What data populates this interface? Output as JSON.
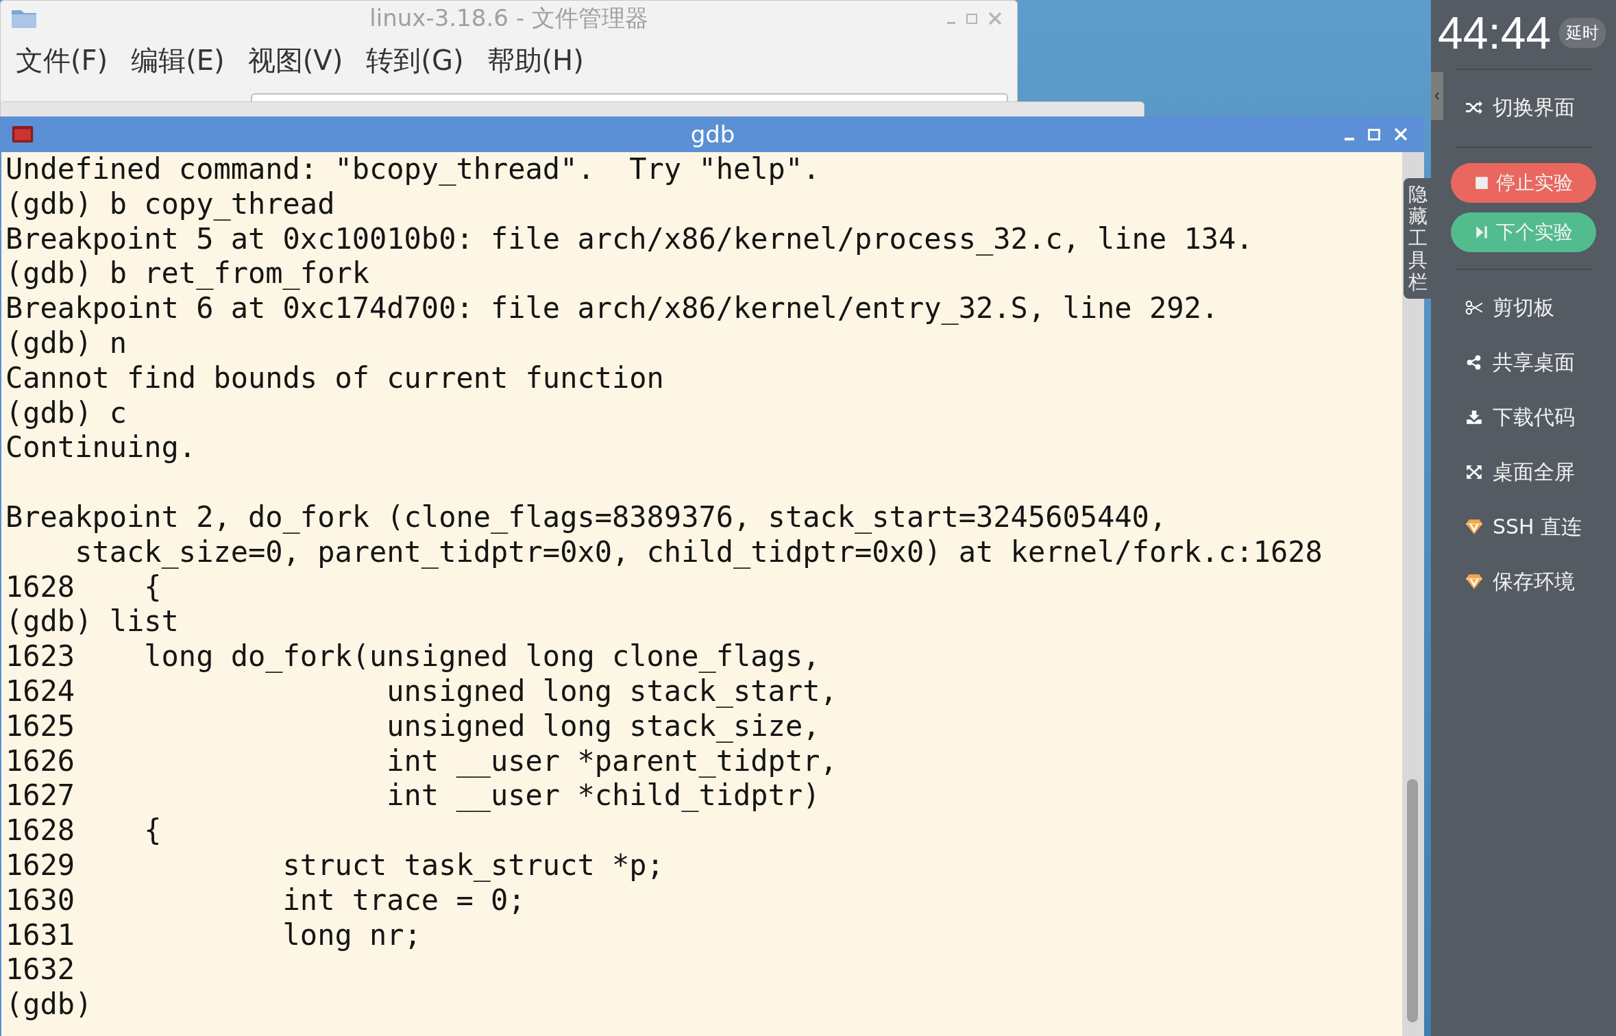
{
  "file_manager": {
    "title": "linux-3.18.6 - 文件管理器",
    "menu": [
      "文件(F)",
      "编辑(E)",
      "视图(V)",
      "转到(G)",
      "帮助(H)"
    ]
  },
  "gdb_window": {
    "title": "gdb",
    "blocks": [
      [
        "Undefined command: \"bcopy_thread\".  Try \"help\".",
        "(gdb) b copy_thread",
        "Breakpoint 5 at 0xc10010b0: file arch/x86/kernel/process_32.c, line 134.",
        "(gdb) b ret_from_fork",
        "Breakpoint 6 at 0xc174d700: file arch/x86/kernel/entry_32.S, line 292.",
        "(gdb) n",
        "Cannot find bounds of current function",
        "(gdb) c",
        "Continuing."
      ],
      [
        "Breakpoint 2, do_fork (clone_flags=8389376, stack_start=3245605440,",
        "    stack_size=0, parent_tidptr=0x0, child_tidptr=0x0) at kernel/fork.c:1628",
        "1628    {",
        "(gdb) list",
        "1623    long do_fork(unsigned long clone_flags,",
        "1624                  unsigned long stack_start,",
        "1625                  unsigned long stack_size,",
        "1626                  int __user *parent_tidptr,",
        "1627                  int __user *child_tidptr)",
        "1628    {",
        "1629            struct task_struct *p;",
        "1630            int trace = 0;",
        "1631            long nr;",
        "1632",
        "(gdb)"
      ]
    ]
  },
  "toolbar_toggle": "隐藏工具栏",
  "side_panel": {
    "timer": "44:44",
    "delay_button": "延时",
    "groups": [
      [
        {
          "kind": "link",
          "label": "切换界面"
        }
      ],
      [
        {
          "kind": "button",
          "label": "停止实验",
          "color": "#e9675f"
        },
        {
          "kind": "button",
          "label": "下个实验",
          "color": "#53bc8f"
        }
      ],
      [
        {
          "kind": "link",
          "label": "剪切板"
        },
        {
          "kind": "link",
          "label": "共享桌面"
        },
        {
          "kind": "link",
          "label": "下载代码"
        },
        {
          "kind": "link",
          "label": "桌面全屏"
        },
        {
          "kind": "link",
          "label": "SSH 直连"
        },
        {
          "kind": "link",
          "label": "保存环境"
        }
      ]
    ]
  }
}
